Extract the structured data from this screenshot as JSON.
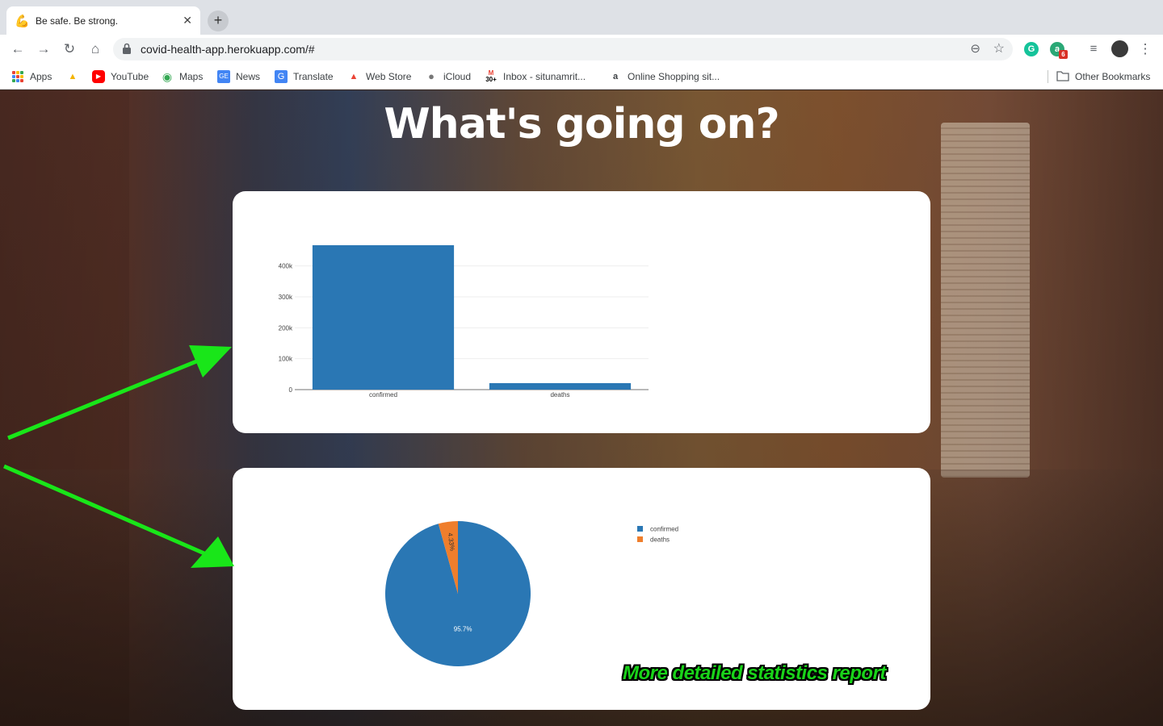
{
  "browser": {
    "tab": {
      "favicon": "flexed-biceps-icon",
      "title": "Be safe. Be strong."
    },
    "url": "covid-health-app.herokuapp.com/#",
    "bookmarks": [
      {
        "label": "Apps",
        "icon": "apps-grid-icon"
      },
      {
        "label": "",
        "icon": "drive-icon"
      },
      {
        "label": "YouTube",
        "icon": "youtube-icon"
      },
      {
        "label": "Maps",
        "icon": "maps-pin-icon"
      },
      {
        "label": "News",
        "icon": "google-news-icon"
      },
      {
        "label": "Translate",
        "icon": "translate-icon"
      },
      {
        "label": "Web Store",
        "icon": "web-store-icon"
      },
      {
        "label": "iCloud",
        "icon": "apple-icon"
      },
      {
        "label": "Inbox - situnamrit...",
        "icon": "gmail-icon"
      },
      {
        "label": "Online Shopping sit...",
        "icon": "amazon-icon"
      }
    ],
    "other_bookmarks": "Other Bookmarks",
    "extensions": {
      "grammarly_badge": "6"
    },
    "gmail_count": "30+"
  },
  "page": {
    "heading": "What's going on?",
    "annotation": "More  detailed statistics report"
  },
  "colors": {
    "series_confirmed": "#2a77b4",
    "series_deaths": "#ef7e2c",
    "arrow": "#19e619"
  },
  "chart_data": [
    {
      "type": "bar",
      "categories": [
        "confirmed",
        "deaths"
      ],
      "values": [
        467000,
        21000
      ],
      "ylim": [
        0,
        480000
      ],
      "yticks": [
        0,
        100000,
        200000,
        300000,
        400000
      ],
      "ytick_labels": [
        "0",
        "100k",
        "200k",
        "300k",
        "400k"
      ],
      "grid": true
    },
    {
      "type": "pie",
      "labels": [
        "confirmed",
        "deaths"
      ],
      "values": [
        95.7,
        4.33
      ],
      "slice_labels": [
        "95.7%",
        "4.33%"
      ],
      "legend": [
        "confirmed",
        "deaths"
      ],
      "legend_position": "top-right"
    }
  ]
}
